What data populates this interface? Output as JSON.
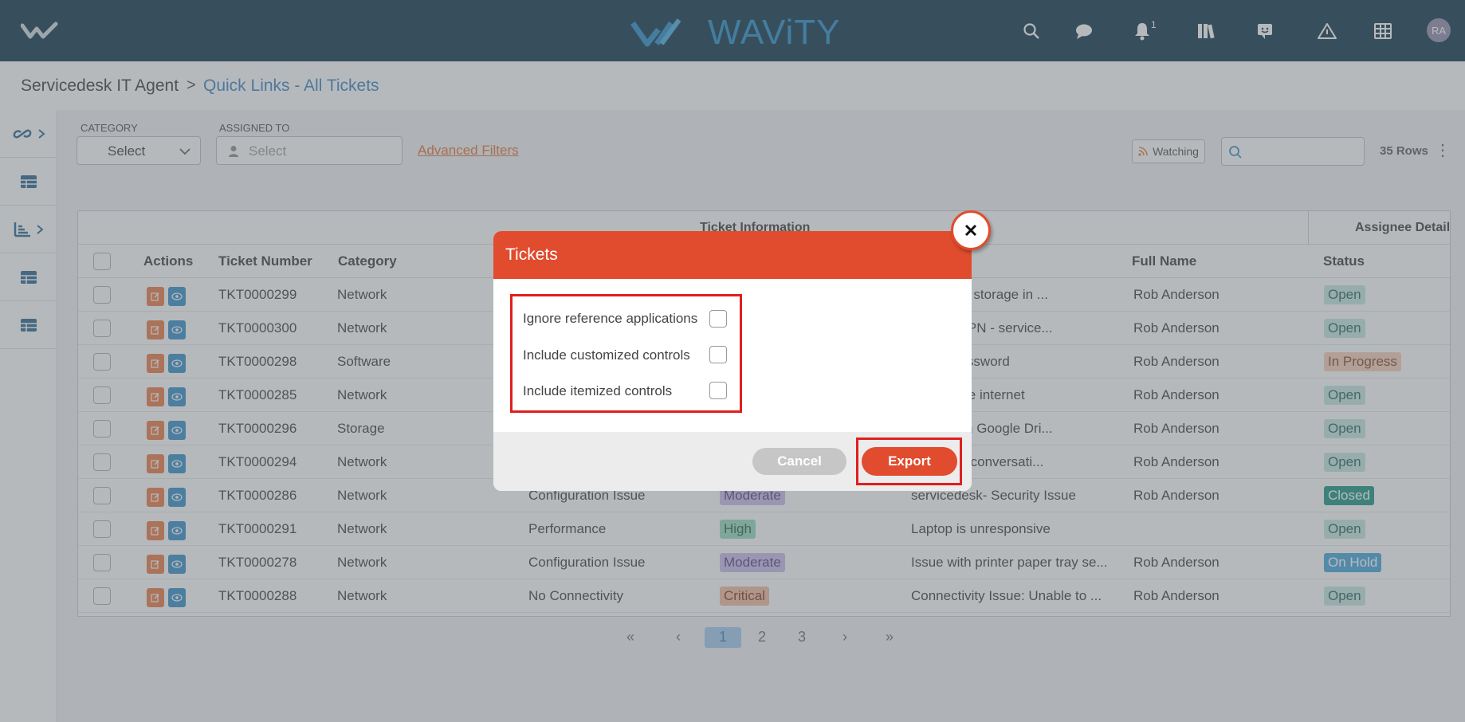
{
  "header": {
    "brand": "WAViTY",
    "notification_count": "1",
    "avatar_initials": "RA"
  },
  "breadcrumb": {
    "root": "Servicedesk IT Agent",
    "separator": ">",
    "current": "Quick Links - All Tickets"
  },
  "filters": {
    "category_label": "CATEGORY",
    "category_value": "Select",
    "assigned_label": "ASSIGNED TO",
    "assigned_placeholder": "Select",
    "advanced_filters": "Advanced Filters",
    "watching": "Watching",
    "rows_count": "35 Rows"
  },
  "table": {
    "group_ticket_info": "Ticket Information",
    "group_assignee": "Assignee Details",
    "columns": {
      "actions": "Actions",
      "ticket_number": "Ticket Number",
      "category": "Category",
      "full_name": "Full Name",
      "status": "Status"
    },
    "rows": [
      {
        "ticket": "TKT0000299",
        "category": "Network",
        "subcat": "",
        "priority": "",
        "subject": "k.org : No storage in ...",
        "name": "Rob Anderson",
        "status": "Open"
      },
      {
        "ticket": "TKT0000300",
        "category": "Network",
        "subcat": "",
        "priority": "",
        "subject": "Access VPN - service...",
        "name": "Rob Anderson",
        "status": "Open"
      },
      {
        "ticket": "TKT0000298",
        "category": "Software",
        "subcat": "",
        "priority": "",
        "subject": "Reset Password",
        "name": "Rob Anderson",
        "status": "In Progress"
      },
      {
        "ticket": "TKT0000285",
        "category": "Network",
        "subcat": "",
        "priority": "",
        "subject": "access the internet",
        "name": "Rob Anderson",
        "status": "Open"
      },
      {
        "ticket": "TKT0000296",
        "category": "Storage",
        "subcat": "",
        "priority": "",
        "subject": "e space in Google Dri...",
        "name": "Rob Anderson",
        "status": "Open"
      },
      {
        "ticket": "TKT0000294",
        "category": "Network",
        "subcat": "",
        "priority": "",
        "subject": "k.org test conversati...",
        "name": "Rob Anderson",
        "status": "Open"
      },
      {
        "ticket": "TKT0000286",
        "category": "Network",
        "subcat": "Configuration Issue",
        "priority": "Moderate",
        "subject": "servicedesk- Security Issue",
        "name": "Rob Anderson",
        "status": "Closed"
      },
      {
        "ticket": "TKT0000291",
        "category": "Network",
        "subcat": "Performance",
        "priority": "High",
        "subject": "Laptop is unresponsive",
        "name": "",
        "status": "Open"
      },
      {
        "ticket": "TKT0000278",
        "category": "Network",
        "subcat": "Configuration Issue",
        "priority": "Moderate",
        "subject": "Issue with printer paper tray se...",
        "name": "Rob Anderson",
        "status": "On Hold"
      },
      {
        "ticket": "TKT0000288",
        "category": "Network",
        "subcat": "No Connectivity",
        "priority": "Critical",
        "subject": "Connectivity Issue: Unable to ...",
        "name": "Rob Anderson",
        "status": "Open"
      }
    ]
  },
  "pagination": {
    "first": "«",
    "prev": "‹",
    "pages": [
      "1",
      "2",
      "3"
    ],
    "next": "›",
    "last": "»",
    "current": "1"
  },
  "modal": {
    "title": "Tickets",
    "options": [
      {
        "label": "Ignore reference applications",
        "checked": false
      },
      {
        "label": "Include customized controls",
        "checked": false
      },
      {
        "label": "Include itemized controls",
        "checked": false
      }
    ],
    "cancel": "Cancel",
    "export": "Export",
    "close": "×"
  },
  "colors": {
    "header_bg": "#012b3e",
    "brand": "#1a87c6",
    "accent_orange": "#e04c2d",
    "link_blue": "#2b7fc0",
    "highlight_red": "#e01e1e"
  }
}
